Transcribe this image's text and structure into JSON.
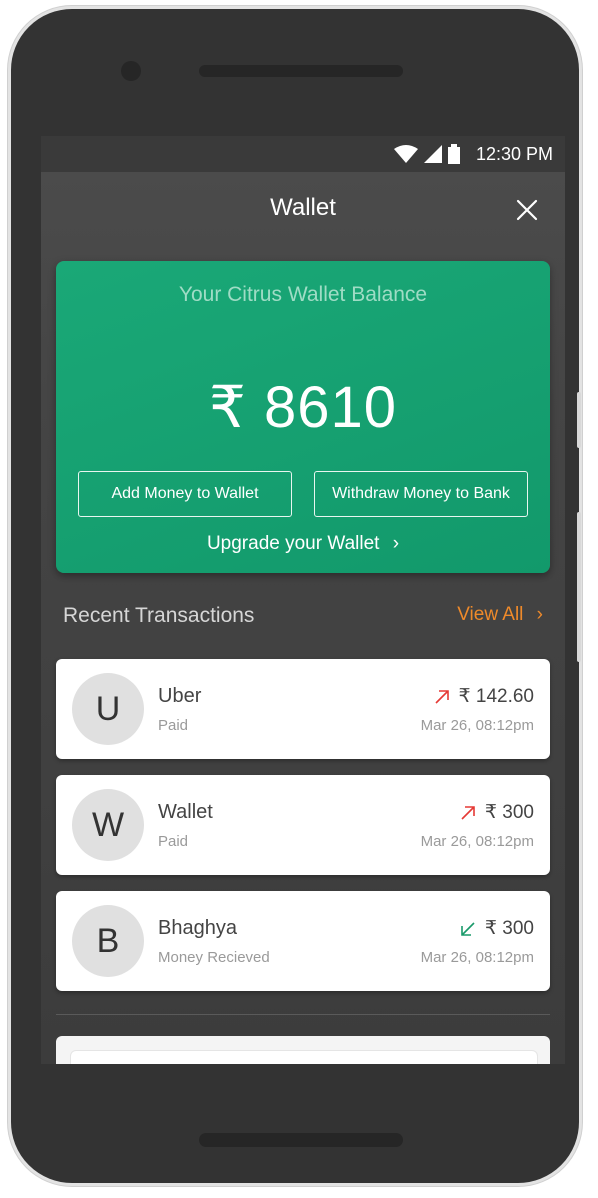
{
  "status_bar": {
    "time": "12:30 PM",
    "icons": [
      "wifi-icon",
      "signal-icon",
      "battery-icon"
    ]
  },
  "header": {
    "title": "Wallet",
    "close_icon": "close-icon"
  },
  "wallet_card": {
    "title": "Your Citrus Wallet Balance",
    "balance": "₹ 8610",
    "add_money_label": "Add Money to Wallet",
    "withdraw_label": "Withdraw Money to Bank",
    "upgrade_label": "Upgrade your Wallet",
    "upgrade_chevron": "›"
  },
  "recent": {
    "title": "Recent Transactions",
    "view_all_label": "View All",
    "view_all_chevron": "›"
  },
  "transactions": [
    {
      "initial": "U",
      "name": "Uber",
      "status": "Paid",
      "amount": "₹ 142.60",
      "date": "Mar 26, 08:12pm",
      "direction": "out"
    },
    {
      "initial": "W",
      "name": "Wallet",
      "status": "Paid",
      "amount": "₹ 300",
      "date": "Mar 26, 08:12pm",
      "direction": "out"
    },
    {
      "initial": "B",
      "name": "Bhaghya",
      "status": "Money Recieved",
      "amount": "₹ 300",
      "date": "Mar 26, 08:12pm",
      "direction": "in"
    }
  ],
  "colors": {
    "accent_green": "#16a171",
    "orange": "#ef8a2a",
    "out_arrow": "#e53935",
    "in_arrow": "#1a9a6a"
  }
}
